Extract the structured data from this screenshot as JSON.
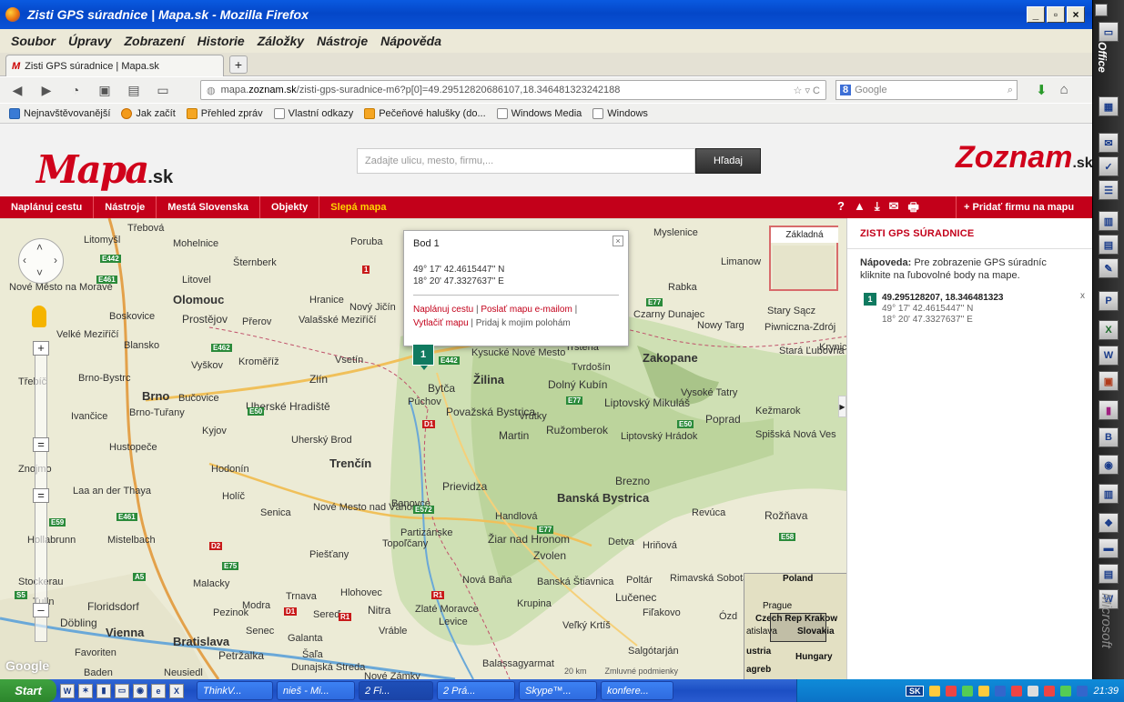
{
  "window": {
    "title": "Zisti GPS súradnice | Mapa.sk - Mozilla Firefox",
    "controls": [
      "_",
      "▫",
      "×"
    ]
  },
  "menu": [
    "Soubor",
    "Úpravy",
    "Zobrazení",
    "Historie",
    "Záložky",
    "Nástroje",
    "Nápověda"
  ],
  "tab": {
    "favicon": "M",
    "title": "Zisti GPS súradnice | Mapa.sk",
    "new_tab": "+"
  },
  "nav": {
    "url_domain": "mapa.zoznam.sk",
    "url_rest": "/zisti-gps-suradnice-m6?p[0]=49.29512820686107,18.346481323242188",
    "url_prefix": "mapa.",
    "url_domain_bold": "zoznam.sk",
    "search_engine": "8",
    "search_placeholder": "Google"
  },
  "bookmarks": [
    {
      "label": "Nejnavštěvovanější",
      "icon": "b"
    },
    {
      "label": "Jak začít",
      "icon": "o"
    },
    {
      "label": "Přehled zpráv",
      "icon": "r"
    },
    {
      "label": "Vlastní odkazy",
      "icon": ""
    },
    {
      "label": "Pečeňové halušky (do...",
      "icon": "r"
    },
    {
      "label": "Windows Media",
      "icon": ""
    },
    {
      "label": "Windows",
      "icon": ""
    }
  ],
  "site": {
    "logo_main": "Mapa",
    "logo_suffix": ".sk",
    "search_placeholder": "Zadajte ulicu, mesto, firmu,...",
    "search_button": "Hľadaj",
    "partner_logo": "Zoznam",
    "partner_suffix": ".sk"
  },
  "rednav": {
    "items": [
      "Naplánuj cestu",
      "Nástroje",
      "Mestá Slovenska",
      "Objekty"
    ],
    "highlight": "Slepá mapa",
    "icons": [
      "?",
      "▲",
      "⤓",
      "✉",
      "🖶"
    ],
    "add_firm": "+ Pridať firmu na mapu"
  },
  "popup": {
    "title": "Bod 1",
    "close": "×",
    "lat": "49° 17' 42.4615447'' N",
    "lon": "18° 20' 47.3327637'' E",
    "link1": "Naplánuj cestu",
    "link2": "Poslať mapu e-mailom",
    "link3": "Vytlačiť mapu",
    "link4": "Pridaj k mojim polohám",
    "sep": "|"
  },
  "marker": {
    "number": "1"
  },
  "layer": {
    "label": "Základná"
  },
  "overview": {
    "labels": [
      "Poland",
      "Prague",
      "Czech Rep",
      "Krakow",
      "Slovakia",
      "atislava",
      "ustria",
      "Hungary",
      "agreb"
    ]
  },
  "map_footer": {
    "scale": "20 km",
    "terms": "Zmluvné podmienky",
    "google": "Google"
  },
  "map_labels": [
    "Třebová",
    "Litomyšl",
    "Mohelnice",
    "Šternberk",
    "Poruba",
    "Myslenice",
    "Limanow",
    "Nové Město na Moravě",
    "Litovel",
    "Olomouc",
    "Hranice",
    "Nový Jičín",
    "Rabka",
    "Stary Sącz",
    "Boskovice",
    "Prostějov",
    "Přerov",
    "Valašské Meziříčí",
    "Czarny Dunajec",
    "Nowy Targ",
    "Piwniczna-Zdrój",
    "Velké Meziříčí",
    "Blansko",
    "Vsetín",
    "Kysucké Nové Mesto",
    "Trstená",
    "Zakopane",
    "Stará Ľubovňa",
    "Krynica",
    "Třebíč",
    "Brno-Bystrc",
    "Brno",
    "Vyškov",
    "Kroměříž",
    "Zlín",
    "Žilina",
    "Bytča",
    "Dolný Kubín",
    "Tvrdošín",
    "Vysoké Tatry",
    "Ivančice",
    "Brno-Tuřany",
    "Bučovice",
    "Uherské Hradiště",
    "Púchov",
    "Považská Bystrica",
    "Vrútky",
    "Liptovský Mikuláš",
    "Kežmarok",
    "Poprad",
    "Kyjov",
    "Uherský Brod",
    "Martin",
    "Ružomberok",
    "Liptovský Hrádok",
    "Spišská Nová Ves",
    "Znojmo",
    "Hustopeče",
    "Hodonín",
    "Trenčín",
    "Prievidza",
    "Brezno",
    "Laa an der Thaya",
    "Holíč",
    "Senica",
    "Nové Mesto nad Váhom",
    "Banovce",
    "Banská Bystrica",
    "Handlová",
    "Revúca",
    "Rožňava",
    "Hollabrunn",
    "Mistelbach",
    "Partizánske",
    "Žiar nad Hronom",
    "Zvolen",
    "Detva",
    "Hriňová",
    "Topoľčany",
    "Piešťany",
    "Banská Štiavnica",
    "Rimavská Sobota",
    "Stockerau",
    "Malacky",
    "Trnava",
    "Hlohovec",
    "Nová Baňa",
    "Poltár",
    "Lučenec",
    "Tulln",
    "Floridsdorf",
    "Modra",
    "Zlaté Moravce",
    "Nitra",
    "Krupina",
    "Fiľakovo",
    "Ózd",
    "Döbling",
    "Vienna",
    "Pezinok",
    "Sereď",
    "Levice",
    "Veľký Krtíš",
    "Bratislava",
    "Senec",
    "Galanta",
    "Vráble",
    "Salgótarján",
    "Favoriten",
    "Petržalka",
    "Šaľa",
    "Dunajská Streda",
    "Nové Zámky",
    "Balassagyarmat",
    "Baden",
    "Neusiedl"
  ],
  "panel": {
    "title": "ZISTI GPS SÚRADNICE",
    "help_bold": "Nápoveda:",
    "help_text": "Pre zobrazenie GPS súradníc kliknite na ľubovolné body na mape.",
    "item_number": "1",
    "item_head": "49.295128207, 18.346481323",
    "item_lat": "49° 17' 42.4615447'' N",
    "item_lon": "18° 20' 47.3327637'' E",
    "item_close": "x"
  },
  "officebar": {
    "title": "Office",
    "footer": "Microsoft"
  },
  "taskbar": {
    "start": "Start",
    "tasks": [
      "ThinkV...",
      "nieš - Mi...",
      "2 Fi...",
      "2 Prá...",
      "Skype™...",
      "konfere..."
    ],
    "tray_lang": "SK",
    "clock": "21:39"
  },
  "colors": {
    "brand_red": "#c3001a",
    "marker_green": "#107a60",
    "xp_blue": "#0a52d6"
  }
}
